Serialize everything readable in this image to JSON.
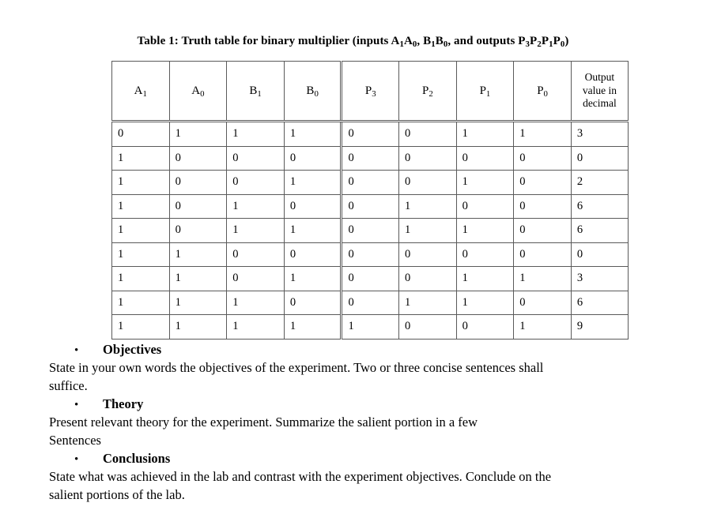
{
  "document": {
    "caption": {
      "prefix": "Table 1: Truth table for binary multiplier (inputs ",
      "a_base": "A",
      "a_sub1": "1",
      "a_base2": "A",
      "a_sub2": "0",
      "mid1": ", ",
      "b_base": "B",
      "b_sub1": "1",
      "b_base2": "B",
      "b_sub2": "0",
      "mid2": ", and outputs ",
      "p3_base": "P",
      "p3_sub": "3",
      "p2_base": "P",
      "p2_sub": "2",
      "p1_base": "P",
      "p1_sub": "1",
      "p0_base": "P",
      "p0_sub": "0",
      "suffix": ")",
      "full_text": "Table 1: Truth table for binary multiplier (inputs A1A0, B1B0, and outputs P3P2P1P0)"
    },
    "table": {
      "headers": [
        {
          "base": "A",
          "sub": "1"
        },
        {
          "base": "A",
          "sub": "0"
        },
        {
          "base": "B",
          "sub": "1"
        },
        {
          "base": "B",
          "sub": "0"
        },
        {
          "base": "P",
          "sub": "3"
        },
        {
          "base": "P",
          "sub": "2"
        },
        {
          "base": "P",
          "sub": "1"
        },
        {
          "base": "P",
          "sub": "0"
        }
      ],
      "decimal_header_line1": "Output",
      "decimal_header_line2": "value in",
      "decimal_header_line3": "decimal",
      "rows": [
        [
          "0",
          "1",
          "1",
          "1",
          "0",
          "0",
          "1",
          "1",
          "3"
        ],
        [
          "1",
          "0",
          "0",
          "0",
          "0",
          "0",
          "0",
          "0",
          "0"
        ],
        [
          "1",
          "0",
          "0",
          "1",
          "0",
          "0",
          "1",
          "0",
          "2"
        ],
        [
          "1",
          "0",
          "1",
          "0",
          "0",
          "1",
          "0",
          "0",
          "6"
        ],
        [
          "1",
          "0",
          "1",
          "1",
          "0",
          "1",
          "1",
          "0",
          "6"
        ],
        [
          "1",
          "1",
          "0",
          "0",
          "0",
          "0",
          "0",
          "0",
          "0"
        ],
        [
          "1",
          "1",
          "0",
          "1",
          "0",
          "0",
          "1",
          "1",
          "3"
        ],
        [
          "1",
          "1",
          "1",
          "0",
          "0",
          "1",
          "1",
          "0",
          "6"
        ],
        [
          "1",
          "1",
          "1",
          "1",
          "1",
          "0",
          "0",
          "1",
          "9"
        ]
      ]
    },
    "sections": [
      {
        "bullet": "•",
        "heading": "Objectives",
        "paragraphs": [
          "State in your own words the objectives of the experiment. Two or three concise sentences shall",
          "suffice."
        ]
      },
      {
        "bullet": "•",
        "heading": "Theory",
        "paragraphs": [
          "Present relevant theory for the experiment. Summarize the salient portion in a few",
          "Sentences"
        ]
      },
      {
        "bullet": "•",
        "heading": "Conclusions",
        "paragraphs": [
          "State what was achieved in the lab and contrast with the experiment objectives. Conclude on the",
          "salient portions of the lab."
        ]
      }
    ]
  },
  "colors": {
    "page_background": "#ffffff",
    "text": "#000000",
    "table_border": "#5a5a5a"
  }
}
